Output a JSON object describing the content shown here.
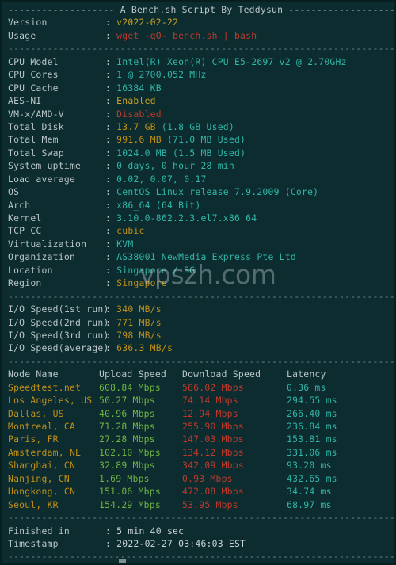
{
  "terminal": {
    "background_color": "#0c2c2f",
    "foreground_color": "#c3ced0",
    "title_banner": "------------------- A Bench.sh Script By Teddysun -------------------",
    "separator": "----------------------------------------------------------------------",
    "watermark": "vpszh.com"
  },
  "colors": {
    "label": "#b8c4c6",
    "cyan": "#2fb6a8",
    "green": "#6fb43f",
    "yellow": "#c9a227",
    "gold": "#c18f16",
    "red": "#c0392b",
    "separator": "#6f8487"
  },
  "header": {
    "version_label": "Version",
    "version_value": "v2022-02-22",
    "usage_label": "Usage",
    "usage_value": "wget -qO- bench.sh | bash"
  },
  "system": [
    {
      "label": "CPU Model",
      "value": "Intel(R) Xeon(R) CPU E5-2697 v2 @ 2.70GHz",
      "color": "cyan"
    },
    {
      "label": "CPU Cores",
      "value": "1 @ 2700.052 MHz",
      "color": "cyan"
    },
    {
      "label": "CPU Cache",
      "value": "16384 KB",
      "color": "cyan"
    },
    {
      "label": "AES-NI",
      "value": "Enabled",
      "color": "yellow"
    },
    {
      "label": "VM-x/AMD-V",
      "value": "Disabled",
      "color": "red"
    },
    {
      "label": "Total Disk",
      "value": "13.7 GB",
      "suffix": " (1.8 GB Used)",
      "color": "gold"
    },
    {
      "label": "Total Mem",
      "value": "991.6 MB",
      "suffix": " (71.0 MB Used)",
      "color": "gold"
    },
    {
      "label": "Total Swap",
      "value": "1024.0 MB",
      "suffix": " (1.5 MB Used)",
      "color": "cyan"
    },
    {
      "label": "System uptime",
      "value": "0 days, 0 hour 28 min",
      "color": "cyan"
    },
    {
      "label": "Load average",
      "value": "0.02, 0.07, 0.17",
      "color": "cyan"
    },
    {
      "label": "OS",
      "value": "CentOS Linux release 7.9.2009 (Core)",
      "color": "cyan"
    },
    {
      "label": "Arch",
      "value": "x86_64 (64 Bit)",
      "color": "cyan"
    },
    {
      "label": "Kernel",
      "value": "3.10.0-862.2.3.el7.x86_64",
      "color": "cyan"
    },
    {
      "label": "TCP CC",
      "value": "cubic",
      "color": "gold"
    },
    {
      "label": "Virtualization",
      "value": "KVM",
      "color": "cyan"
    },
    {
      "label": "Organization",
      "value": "AS38001 NewMedia Express Pte Ltd",
      "color": "cyan"
    },
    {
      "label": "Location",
      "value": "Singapore / SG",
      "color": "cyan"
    },
    {
      "label": "Region",
      "value": "Singapore",
      "color": "gold"
    }
  ],
  "io_speed": [
    {
      "label": "I/O Speed(1st run)",
      "value": "340 MB/s"
    },
    {
      "label": "I/O Speed(2nd run)",
      "value": "771 MB/s"
    },
    {
      "label": "I/O Speed(3rd run)",
      "value": "798 MB/s"
    },
    {
      "label": "I/O Speed(average)",
      "value": "636.3 MB/s"
    }
  ],
  "speedtest": {
    "columns": [
      "Node Name",
      "Upload Speed",
      "Download Speed",
      "Latency"
    ],
    "rows": [
      {
        "node": "Speedtest.net",
        "upload": "608.84 Mbps",
        "download": "586.02 Mbps",
        "latency": "0.36 ms"
      },
      {
        "node": "Los Angeles, US",
        "upload": "50.27 Mbps",
        "download": "74.14 Mbps",
        "latency": "294.55 ms"
      },
      {
        "node": "Dallas, US",
        "upload": "40.96 Mbps",
        "download": "12.94 Mbps",
        "latency": "266.40 ms"
      },
      {
        "node": "Montreal, CA",
        "upload": "71.28 Mbps",
        "download": "255.90 Mbps",
        "latency": "236.84 ms"
      },
      {
        "node": "Paris, FR",
        "upload": "27.28 Mbps",
        "download": "147.03 Mbps",
        "latency": "153.81 ms"
      },
      {
        "node": "Amsterdam, NL",
        "upload": "102.10 Mbps",
        "download": "134.12 Mbps",
        "latency": "331.06 ms"
      },
      {
        "node": "Shanghai, CN",
        "upload": "32.89 Mbps",
        "download": "342.09 Mbps",
        "latency": "93.20 ms"
      },
      {
        "node": "Nanjing, CN",
        "upload": "1.69 Mbps",
        "download": "0.93 Mbps",
        "latency": "432.65 ms"
      },
      {
        "node": "Hongkong, CN",
        "upload": "151.06 Mbps",
        "download": "472.08 Mbps",
        "latency": "34.74 ms"
      },
      {
        "node": "Seoul, KR",
        "upload": "154.29 Mbps",
        "download": "53.95 Mbps",
        "latency": "68.97 ms"
      }
    ]
  },
  "footer": {
    "finished_label": "Finished in",
    "finished_value": "5 min 40 sec",
    "timestamp_label": "Timestamp",
    "timestamp_value": "2022-02-27 03:46:03 EST"
  }
}
